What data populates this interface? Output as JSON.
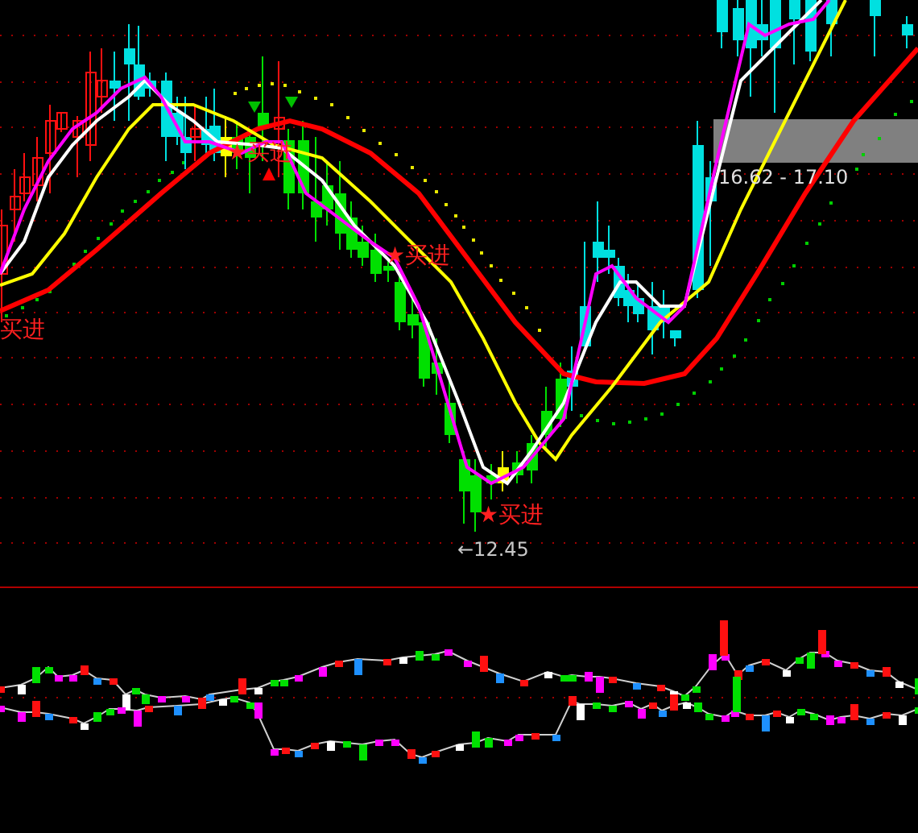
{
  "price_panel": {
    "signals": [
      {
        "text": "买进"
      },
      {
        "text": "★买进"
      },
      {
        "text": "★买进"
      },
      {
        "text": "★买进"
      }
    ],
    "low_marker": {
      "text": "←12.45"
    },
    "range_marker": {
      "text": "16.62 - 17.10"
    }
  }
}
